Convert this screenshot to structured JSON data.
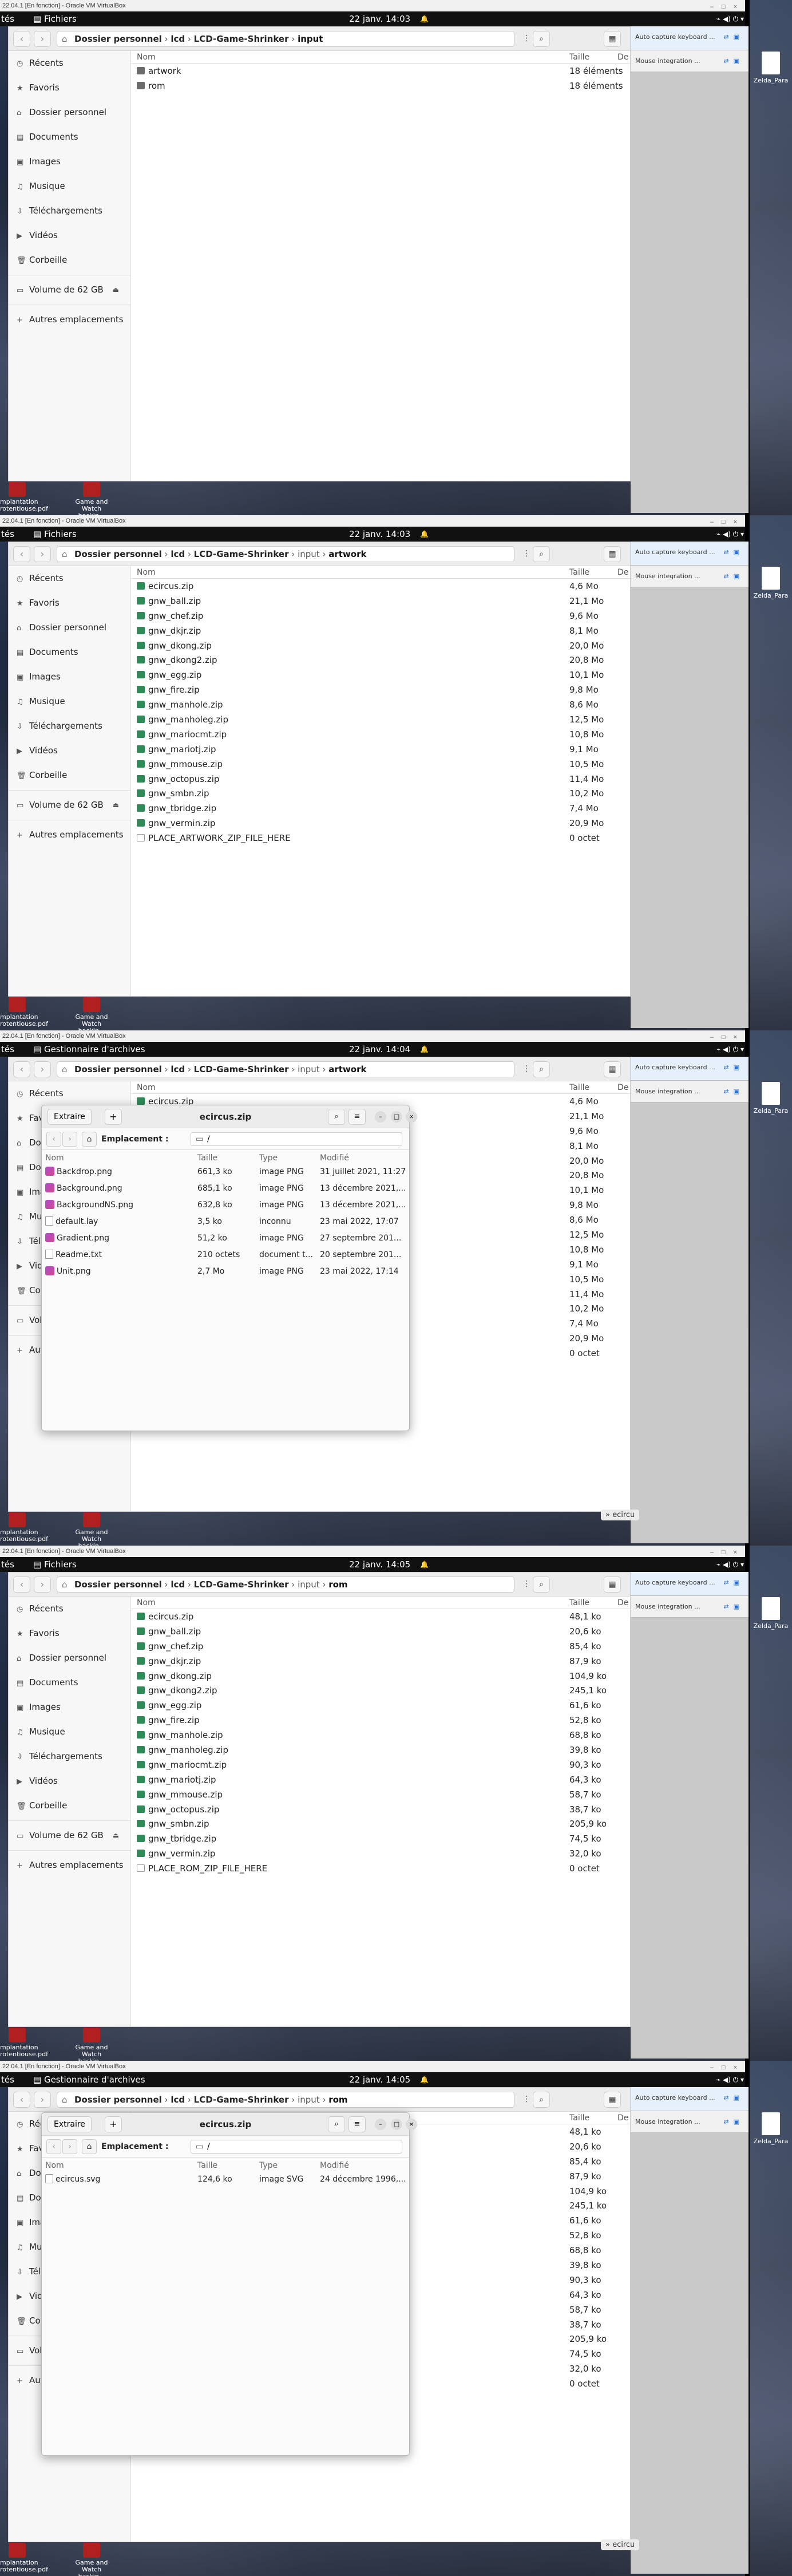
{
  "vbox": {
    "title": "22.04.1 [En fonction] - Oracle VM VirtualBox"
  },
  "topbar": {
    "activities": "tés",
    "files_app": "Fichiers",
    "archive_app": "Gestionnaire d'archives",
    "clock_1": "22 janv.  14:03",
    "clock_3": "22 janv.  14:04",
    "clock_5": "22 janv.  14:05",
    "bell": "🔔"
  },
  "sidebar": [
    "Récents",
    "Favoris",
    "Dossier personnel",
    "Documents",
    "Images",
    "Musique",
    "Téléchargements",
    "Vidéos",
    "Corbeille"
  ],
  "sidebar_icons": [
    "clock-icon",
    "star-icon",
    "home-icon",
    "document-icon",
    "image-icon",
    "music-icon",
    "download-icon",
    "video-icon",
    "trash-icon"
  ],
  "sidebar_glyphs": [
    "◷",
    "★",
    "⌂",
    "▤",
    "▣",
    "♫",
    "⇩",
    "▶",
    "🗑"
  ],
  "volume": "Volume de 62 GB",
  "other": "Autres emplacements",
  "path": {
    "home": "⌂",
    "p1": "Dossier personnel",
    "p2": "lcd",
    "p3": "LCD-Game-Shrinker",
    "p4": "input",
    "p5_art": "artwork",
    "p5_rom": "rom",
    "sep": "›"
  },
  "columns": {
    "name": "Nom",
    "size": "Taille",
    "date": "De"
  },
  "input_rows": [
    {
      "name": "artwork",
      "size": "18 éléments"
    },
    {
      "name": "rom",
      "size": "18 éléments"
    }
  ],
  "artwork_rows": [
    {
      "name": "ecircus.zip",
      "size": "4,6 Mo"
    },
    {
      "name": "gnw_ball.zip",
      "size": "21,1 Mo"
    },
    {
      "name": "gnw_chef.zip",
      "size": "9,6 Mo"
    },
    {
      "name": "gnw_dkjr.zip",
      "size": "8,1 Mo"
    },
    {
      "name": "gnw_dkong.zip",
      "size": "20,0 Mo"
    },
    {
      "name": "gnw_dkong2.zip",
      "size": "20,8 Mo"
    },
    {
      "name": "gnw_egg.zip",
      "size": "10,1 Mo"
    },
    {
      "name": "gnw_fire.zip",
      "size": "9,8 Mo"
    },
    {
      "name": "gnw_manhole.zip",
      "size": "8,6 Mo"
    },
    {
      "name": "gnw_manholeg.zip",
      "size": "12,5 Mo"
    },
    {
      "name": "gnw_mariocmt.zip",
      "size": "10,8 Mo"
    },
    {
      "name": "gnw_mariotj.zip",
      "size": "9,1 Mo"
    },
    {
      "name": "gnw_mmouse.zip",
      "size": "10,5 Mo"
    },
    {
      "name": "gnw_octopus.zip",
      "size": "11,4 Mo"
    },
    {
      "name": "gnw_smbn.zip",
      "size": "10,2 Mo"
    },
    {
      "name": "gnw_tbridge.zip",
      "size": "7,4 Mo"
    },
    {
      "name": "gnw_vermin.zip",
      "size": "20,9 Mo"
    },
    {
      "name": "PLACE_ARTWORK_ZIP_FILE_HERE",
      "size": "0 octet"
    }
  ],
  "rom_rows": [
    {
      "name": "ecircus.zip",
      "size": "48,1 ko"
    },
    {
      "name": "gnw_ball.zip",
      "size": "20,6 ko"
    },
    {
      "name": "gnw_chef.zip",
      "size": "85,4 ko"
    },
    {
      "name": "gnw_dkjr.zip",
      "size": "87,9 ko"
    },
    {
      "name": "gnw_dkong.zip",
      "size": "104,9 ko"
    },
    {
      "name": "gnw_dkong2.zip",
      "size": "245,1 ko"
    },
    {
      "name": "gnw_egg.zip",
      "size": "61,6 ko"
    },
    {
      "name": "gnw_fire.zip",
      "size": "52,8 ko"
    },
    {
      "name": "gnw_manhole.zip",
      "size": "68,8 ko"
    },
    {
      "name": "gnw_manholeg.zip",
      "size": "39,8 ko"
    },
    {
      "name": "gnw_mariocmt.zip",
      "size": "90,3 ko"
    },
    {
      "name": "gnw_mariotj.zip",
      "size": "64,3 ko"
    },
    {
      "name": "gnw_mmouse.zip",
      "size": "58,7 ko"
    },
    {
      "name": "gnw_octopus.zip",
      "size": "38,7 ko"
    },
    {
      "name": "gnw_smbn.zip",
      "size": "205,9 ko"
    },
    {
      "name": "gnw_tbridge.zip",
      "size": "74,5 ko"
    },
    {
      "name": "gnw_vermin.zip",
      "size": "32,0 ko"
    },
    {
      "name": "PLACE_ROM_ZIP_FILE_HERE",
      "size": "0 octet"
    }
  ],
  "archive": {
    "title": "ecircus.zip",
    "extract": "Extraire",
    "plus": "+",
    "location_label": "Emplacement :",
    "location_value": "/",
    "cols": {
      "name": "Nom",
      "size": "Taille",
      "type": "Type",
      "modified": "Modifié"
    },
    "rows_art": [
      {
        "name": "Backdrop.png",
        "size": "661,3 ko",
        "type": "image PNG",
        "mod": "31 juillet 2021, 11:27",
        "k": "img"
      },
      {
        "name": "Background.png",
        "size": "685,1 ko",
        "type": "image PNG",
        "mod": "13 décembre 2021,...",
        "k": "img"
      },
      {
        "name": "BackgroundNS.png",
        "size": "632,8 ko",
        "type": "image PNG",
        "mod": "13 décembre 2021,...",
        "k": "img"
      },
      {
        "name": "default.lay",
        "size": "3,5 ko",
        "type": "inconnu",
        "mod": "23 mai 2022, 17:07",
        "k": "gen"
      },
      {
        "name": "Gradient.png",
        "size": "51,2 ko",
        "type": "image PNG",
        "mod": "27 septembre 201...",
        "k": "img"
      },
      {
        "name": "Readme.txt",
        "size": "210 octets",
        "type": "document t...",
        "mod": "20 septembre 201...",
        "k": "gen"
      },
      {
        "name": "Unit.png",
        "size": "2,7 Mo",
        "type": "image PNG",
        "mod": "23 mai 2022, 17:14",
        "k": "img"
      }
    ],
    "rows_rom": [
      {
        "name": "ecircus.svg",
        "size": "124,6 ko",
        "type": "image SVG",
        "mod": "24 décembre 1996,...",
        "k": "svg"
      }
    ]
  },
  "vbox_side": {
    "row1": "Auto capture keyboard ...",
    "row2": "Mouse integration ..."
  },
  "desktop": {
    "icon_label": "Zelda_Para"
  },
  "dock": {
    "item1": "mplantation rotentiouse.pdf",
    "item2": "Game and Watch hackin..."
  },
  "hint": "» ecircu"
}
